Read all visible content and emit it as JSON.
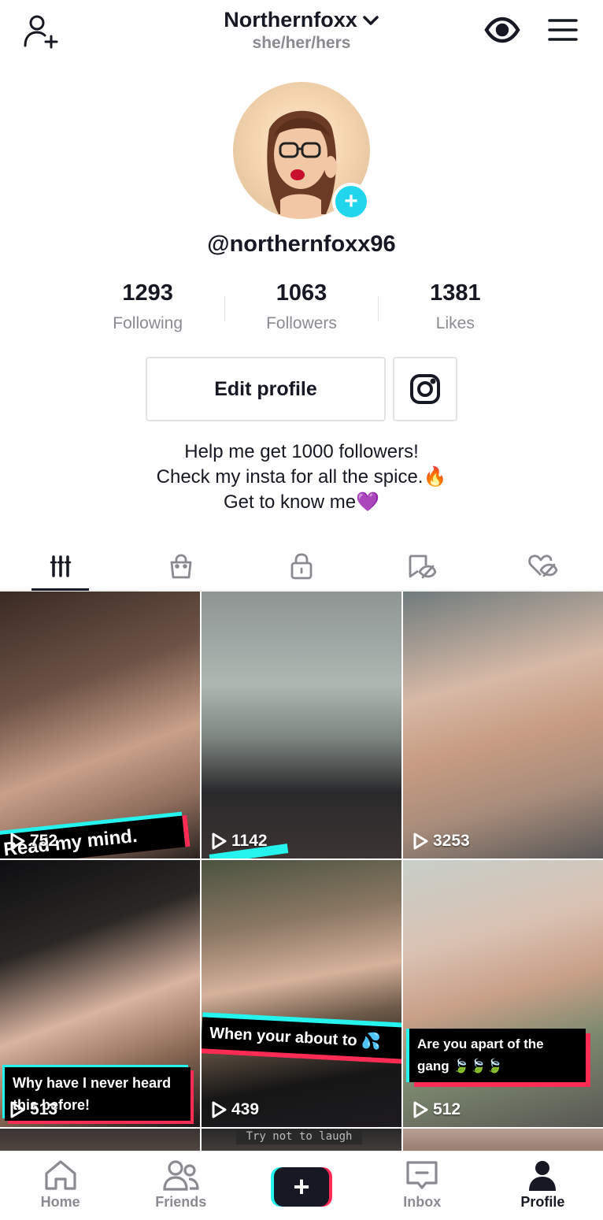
{
  "header": {
    "username": "Northernfoxx",
    "pronouns": "she/her/hers"
  },
  "profile": {
    "handle": "@northernfoxx96",
    "stats": [
      {
        "value": "1293",
        "label": "Following"
      },
      {
        "value": "1063",
        "label": "Followers"
      },
      {
        "value": "1381",
        "label": "Likes"
      }
    ],
    "edit_label": "Edit profile",
    "bio": [
      "Help me get 1000 followers!",
      "Check my insta for all the spice.🔥",
      "Get to know me💜"
    ]
  },
  "tabs": [
    "videos",
    "shop",
    "private",
    "favorites",
    "liked"
  ],
  "videos": [
    {
      "views": "752",
      "caption": "Read my mind."
    },
    {
      "views": "1142",
      "caption": ""
    },
    {
      "views": "3253",
      "caption": ""
    },
    {
      "views": "513",
      "caption": "Why have I never heard this before!"
    },
    {
      "views": "439",
      "caption": "When your about to 💦"
    },
    {
      "views": "512",
      "caption": "Are you apart of the gang 🍃🍃🍃"
    }
  ],
  "partial_caption": "Try not to laugh",
  "nav": {
    "home": "Home",
    "friends": "Friends",
    "inbox": "Inbox",
    "profile": "Profile"
  },
  "colors": {
    "accent_cyan": "#25f4ee",
    "accent_pink": "#fe2c55",
    "avatar_add": "#20d5ec"
  }
}
